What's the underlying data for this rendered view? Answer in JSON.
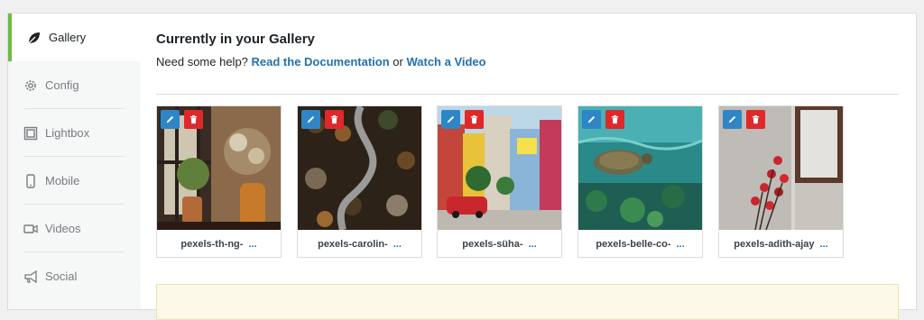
{
  "sidebar": {
    "items": [
      {
        "label": "Gallery",
        "icon": "leaf-icon",
        "active": true
      },
      {
        "label": "Config",
        "icon": "gear-icon",
        "active": false
      },
      {
        "label": "Lightbox",
        "icon": "lightbox-icon",
        "active": false
      },
      {
        "label": "Mobile",
        "icon": "mobile-icon",
        "active": false
      },
      {
        "label": "Videos",
        "icon": "video-icon",
        "active": false
      },
      {
        "label": "Social",
        "icon": "megaphone-icon",
        "active": false
      }
    ]
  },
  "main": {
    "title": "Currently in your Gallery",
    "help_prefix": "Need some help?",
    "help_link_docs": "Read the Documentation",
    "help_or": "or",
    "help_link_video": "Watch a Video"
  },
  "gallery": {
    "items": [
      {
        "name": "pexels-th-ng-",
        "more": "..."
      },
      {
        "name": "pexels-carolin-",
        "more": "..."
      },
      {
        "name": "pexels-süha-",
        "more": "..."
      },
      {
        "name": "pexels-belle-co-",
        "more": "..."
      },
      {
        "name": "pexels-adith-ajay",
        "more": "..."
      }
    ]
  },
  "colors": {
    "active_accent": "#6fbb40",
    "link": "#2271b1",
    "edit_button": "#2f86c6",
    "delete_button": "#e0282a"
  }
}
